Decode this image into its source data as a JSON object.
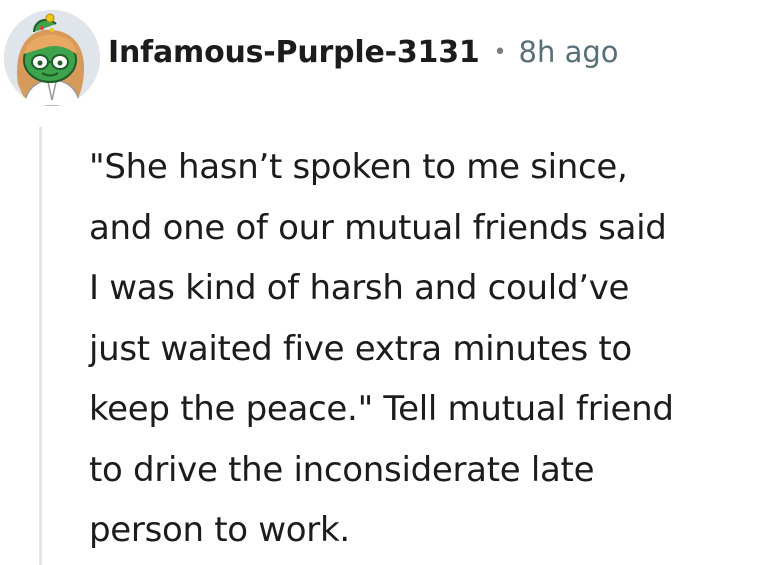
{
  "comment": {
    "author": "Infamous-Purple-3131",
    "separator": "•",
    "timestamp": "8h ago",
    "avatar_icon": "snoo-avatar-icon",
    "body": "\"She hasn’t spoken to me since,\nand one of our mutual friends said\nI was kind of harsh and could’ve\njust waited five extra minutes to\nkeep the peace.\" Tell mutual friend\nto drive the inconsiderate late\nperson to work."
  },
  "colors": {
    "author_text": "#1c1c1c",
    "meta_text": "#576f76",
    "thread_line": "#e2e6e8",
    "avatar_bg": "#dfe5ea",
    "avatar_skin": "#3fa34d"
  }
}
